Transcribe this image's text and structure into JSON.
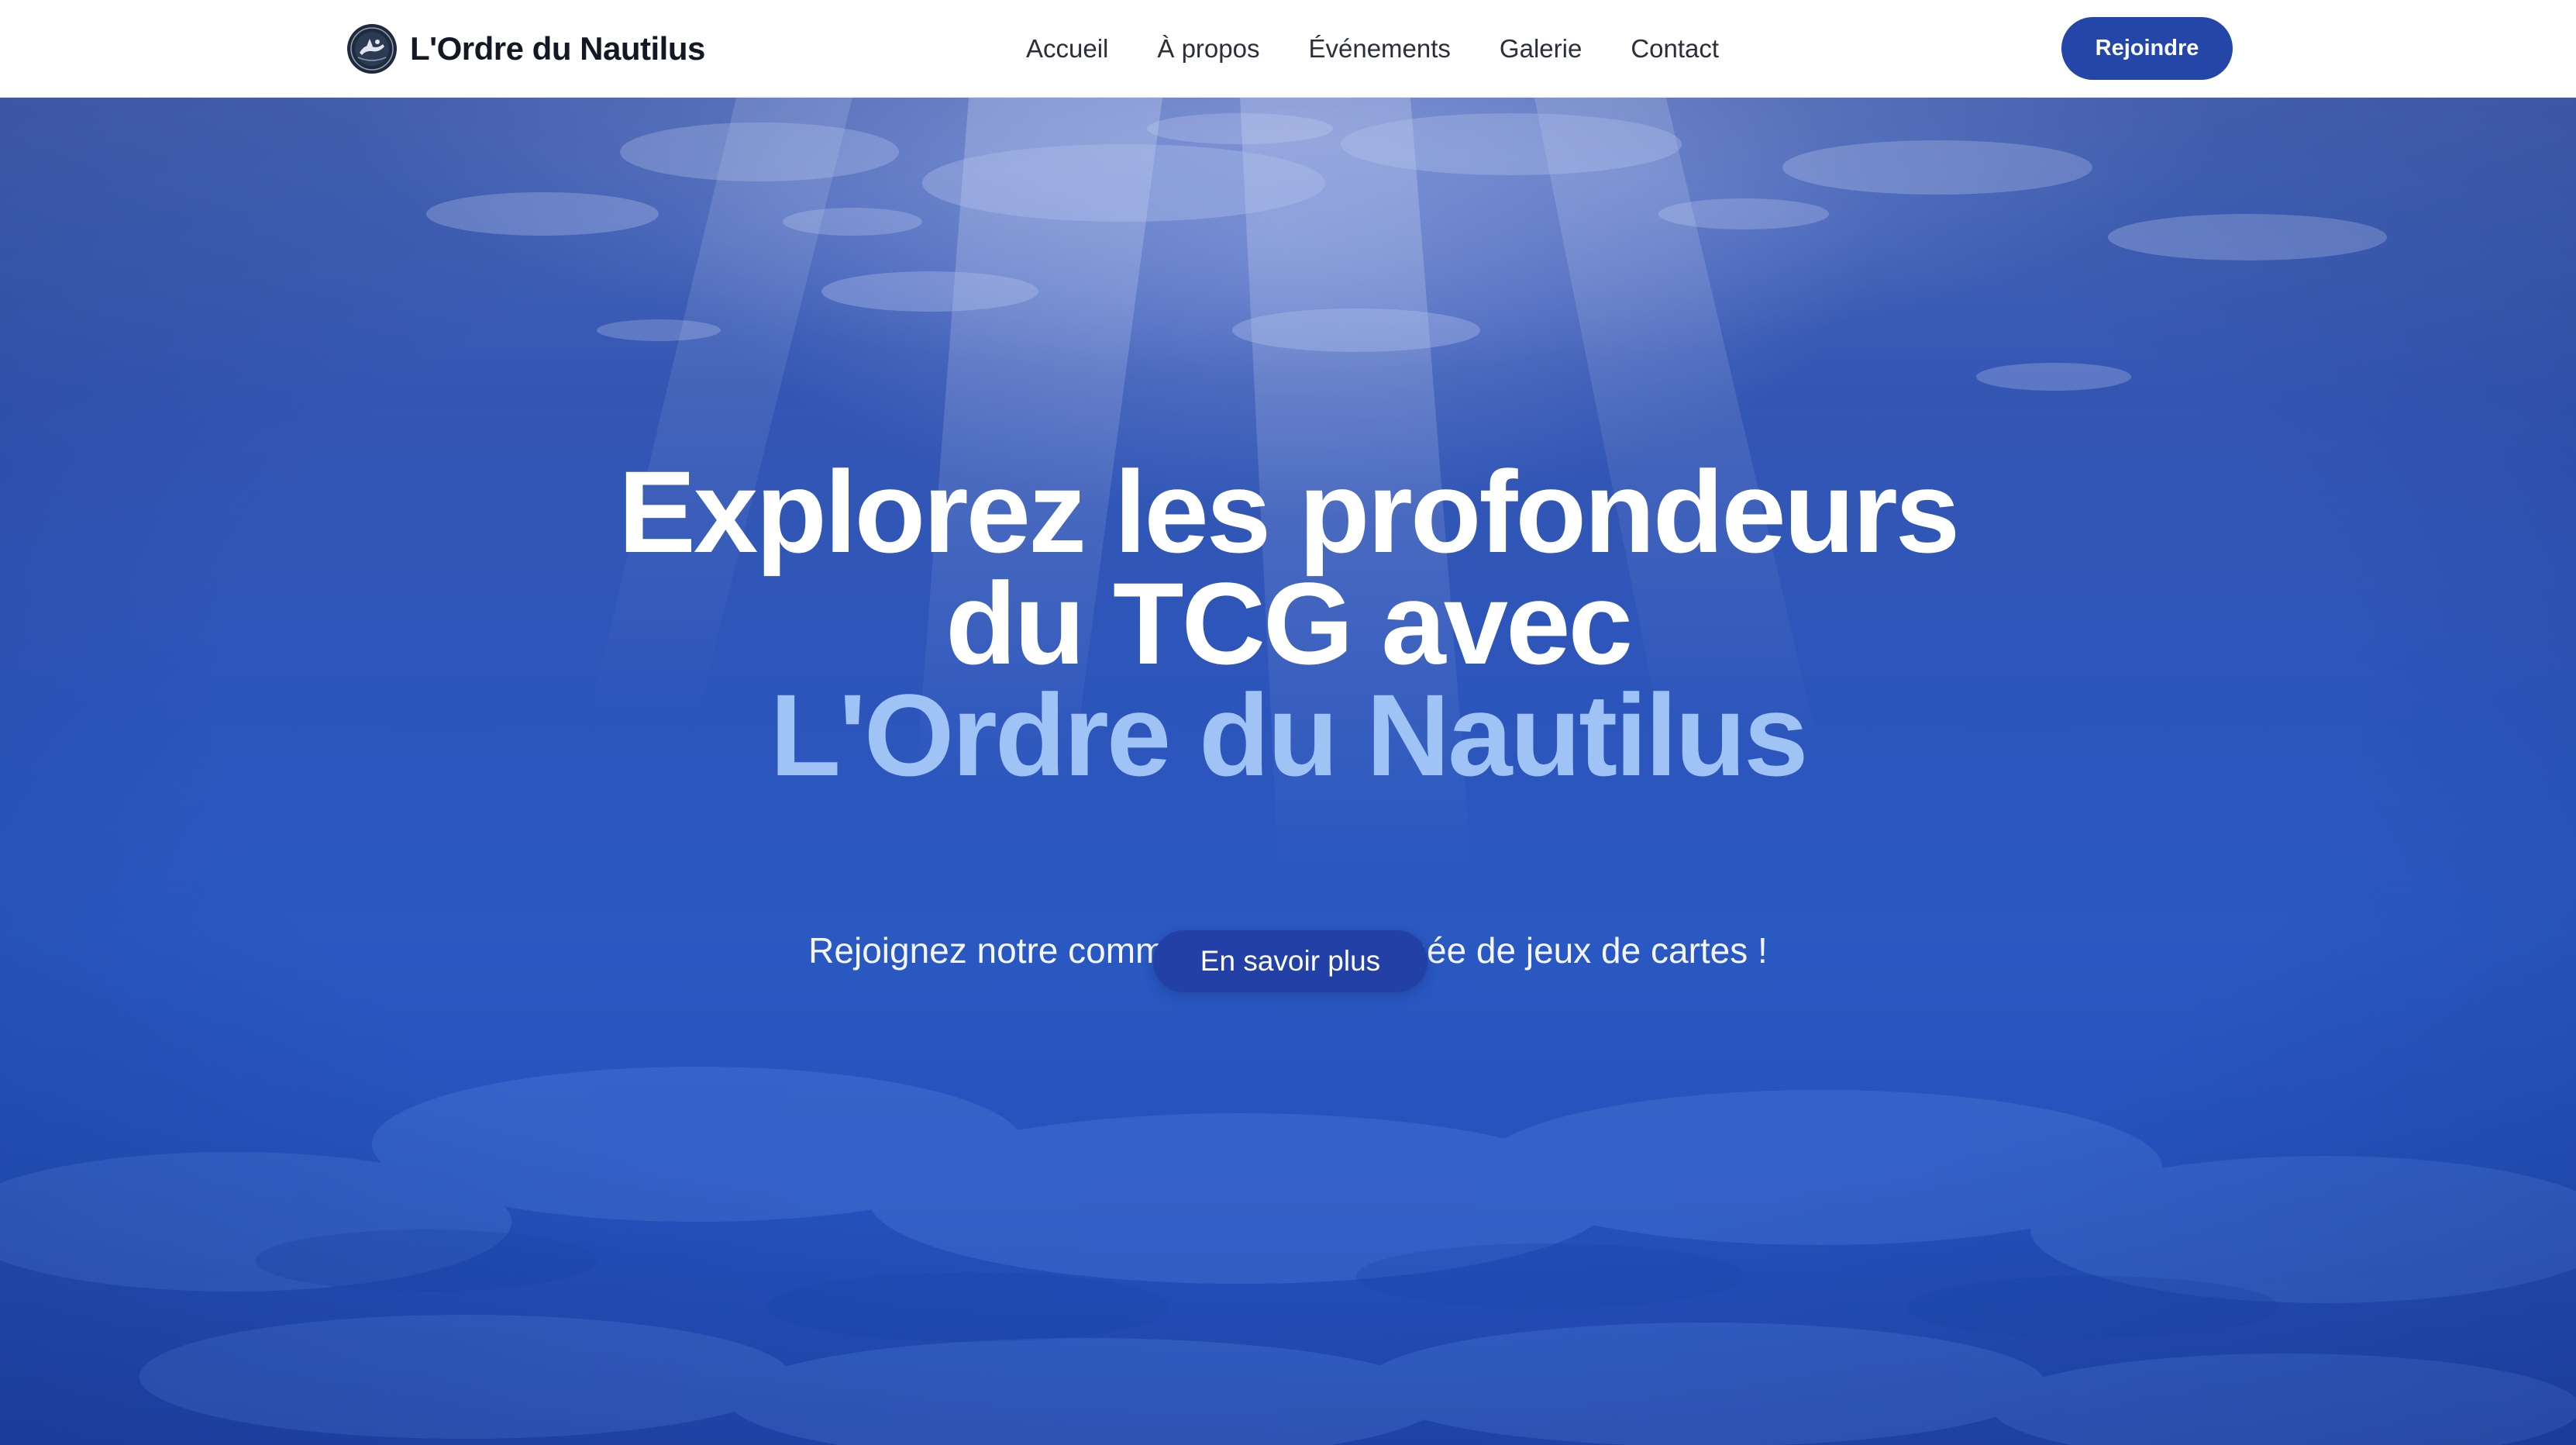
{
  "brand": {
    "name": "L'Ordre du Nautilus"
  },
  "nav": {
    "items": [
      {
        "label": "Accueil"
      },
      {
        "label": "À propos"
      },
      {
        "label": "Événements"
      },
      {
        "label": "Galerie"
      },
      {
        "label": "Contact"
      }
    ],
    "join_label": "Rejoindre"
  },
  "hero": {
    "title_line1": "Explorez les profondeurs",
    "title_line2": "du TCG avec",
    "title_accent": "L'Ordre du Nautilus",
    "subtitle": "Rejoignez notre communauté passionnée de jeux de cartes !",
    "cta_label": "En savoir plus"
  },
  "colors": {
    "header_bg": "#ffffff",
    "brand_text": "#141824",
    "button_primary": "#2346a8",
    "hero_title": "#ffffff",
    "hero_accent": "#9ec3f4",
    "hero_bg": "#2a59c2"
  },
  "icons": {
    "logo": "nautilus-emblem-icon"
  }
}
